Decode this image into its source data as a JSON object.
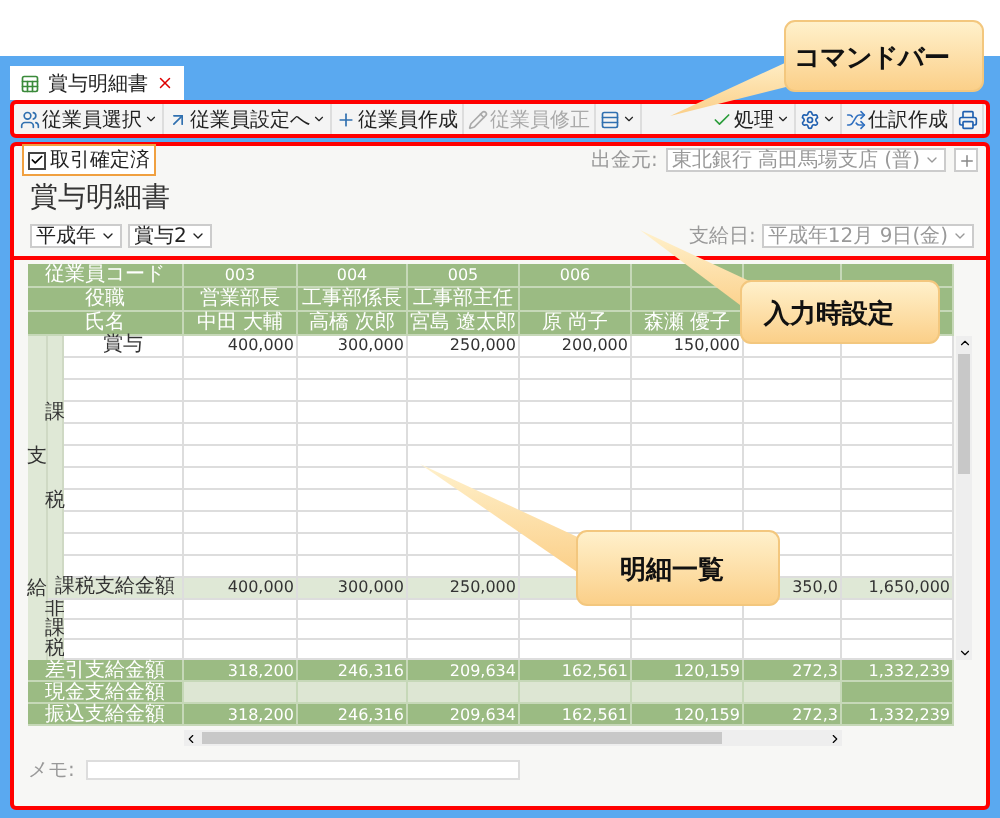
{
  "tab": {
    "title": "賞与明細書",
    "selected": true
  },
  "toolbar": {
    "left": [
      {
        "label": "従業員選択",
        "dropdown": true,
        "disabled": false
      },
      {
        "label": "従業員設定へ",
        "dropdown": true,
        "disabled": false
      },
      {
        "label": "従業員作成",
        "dropdown": false,
        "disabled": false
      },
      {
        "label": "従業員修正",
        "dropdown": false,
        "disabled": true
      },
      {
        "dropdown": true,
        "disabled": false
      }
    ],
    "right": [
      {
        "label": "処理",
        "dropdown": true,
        "disabled": false
      },
      {
        "dropdown": true,
        "disabled": false
      },
      {
        "label": "仕訳作成",
        "dropdown": false,
        "disabled": false
      },
      {
        "dropdown": false,
        "disabled": false
      }
    ]
  },
  "confirm": {
    "label": "取引確定済",
    "checked": true
  },
  "payer": {
    "label": "出金元:",
    "value": "東北銀行 高田馬場支店 (普)"
  },
  "title": "賞与明細書",
  "selectors": [
    {
      "value": "平成年"
    },
    {
      "value": "賞与2"
    }
  ],
  "pay_date": {
    "label": "支給日:",
    "value": "平成年12月 9日(金)"
  },
  "table": {
    "header_rows": [
      {
        "label": "従業員コード",
        "cells": [
          "003",
          "004",
          "005",
          "006",
          null,
          null,
          null
        ]
      },
      {
        "label": "役職",
        "cells": [
          "営業部長",
          "工事部係長",
          "工事部主任",
          null,
          null,
          null,
          null
        ]
      },
      {
        "label": "氏名",
        "cells": [
          "中田 大輔",
          "高橋 次郎",
          "宮島 遼太郎",
          "原 尚子",
          "森瀬 優子",
          null,
          null
        ]
      }
    ],
    "section_top": "支",
    "section_bottom": "給",
    "taxable": {
      "group": "課税",
      "rows": [
        {
          "label": "賞与",
          "cells": [
            "400,000",
            "300,000",
            "250,000",
            "200,000",
            "150,000",
            null,
            null
          ]
        }
      ],
      "total": {
        "label": "課税支給金額",
        "cells": [
          "400,000",
          "300,000",
          "250,000",
          null,
          null,
          "350,0",
          "1,650,000"
        ]
      }
    },
    "nontaxable": {
      "group": "非課税"
    },
    "footer_rows": [
      {
        "label": "差引支給金額",
        "kind": "amount",
        "cells": [
          "318,200",
          "246,316",
          "209,634",
          "162,561",
          "120,159",
          "272,3",
          "1,332,239"
        ]
      },
      {
        "label": "現金支給金額",
        "kind": "entry",
        "cells": [
          null,
          null,
          null,
          null,
          null,
          null,
          null
        ]
      },
      {
        "label": "振込支給金額",
        "kind": "amount",
        "cells": [
          "318,200",
          "246,316",
          "209,634",
          "162,561",
          "120,159",
          "272,3",
          "1,332,239"
        ]
      }
    ]
  },
  "memo": {
    "label": "メモ:"
  },
  "callouts": [
    {
      "text": "コマンドバー"
    },
    {
      "text": "入力時設定"
    },
    {
      "text": "明細一覧"
    }
  ]
}
